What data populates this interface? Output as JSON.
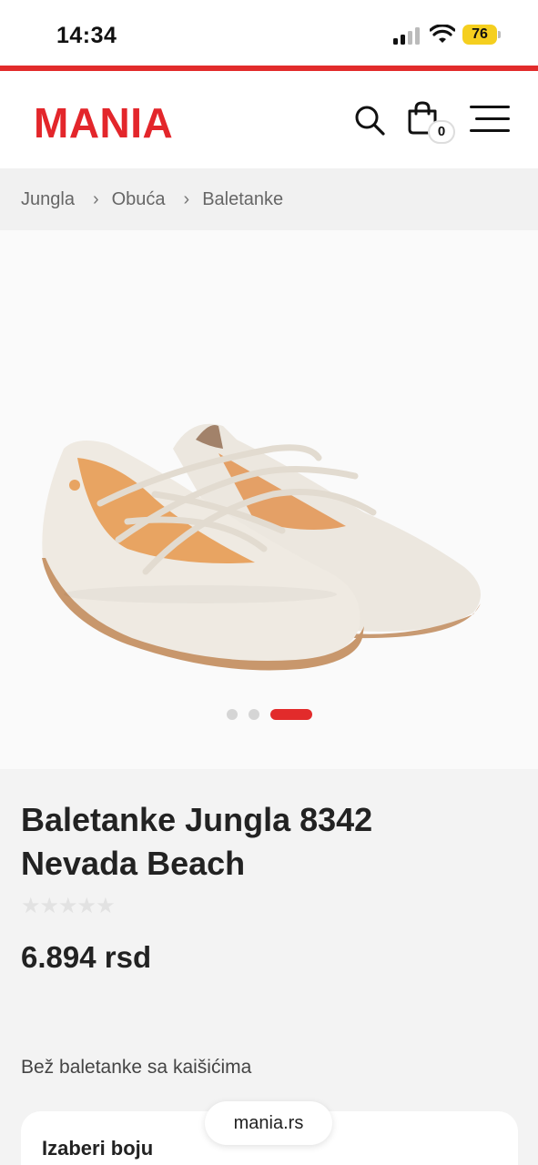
{
  "status_bar": {
    "time": "14:34",
    "battery": "76"
  },
  "header": {
    "logo": "MANIA",
    "cart_count": "0"
  },
  "breadcrumb": [
    "Jungla",
    "Obuća",
    "Baletanke"
  ],
  "gallery": {
    "slides": 3,
    "active_slide": 3
  },
  "product": {
    "title": "Baletanke Jungla 8342 Nevada Beach",
    "rating_stars": "★★★★★",
    "rating": 0,
    "price": "6.894 rsd",
    "description": "Bež baletanke sa kaišićima",
    "color_label": "Izaberi boju"
  },
  "browser": {
    "url": "mania.rs"
  },
  "colors": {
    "brand": "#e3262b",
    "accent_bar": "#e22b2b",
    "battery": "#f5cf1f"
  }
}
